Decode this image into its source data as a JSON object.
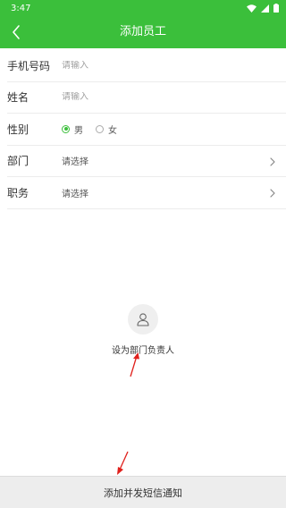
{
  "status_bar": {
    "time": "3:47"
  },
  "app_bar": {
    "title": "添加员工",
    "back_icon": "chevron-left-icon"
  },
  "form": {
    "phone": {
      "label": "手机号码",
      "placeholder": "请输入",
      "value": ""
    },
    "name": {
      "label": "姓名",
      "placeholder": "请输入",
      "value": ""
    },
    "gender": {
      "label": "性别",
      "options": [
        {
          "label": "男",
          "checked": true
        },
        {
          "label": "女",
          "checked": false
        }
      ]
    },
    "department": {
      "label": "部门",
      "value": "请选择"
    },
    "position": {
      "label": "职务",
      "value": "请选择"
    }
  },
  "dept_head": {
    "label": "设为部门负责人",
    "icon": "person-icon"
  },
  "bottom": {
    "submit_label": "添加并发短信通知"
  },
  "colors": {
    "accent": "#3bbf3b",
    "annotation": "#e0201c",
    "bottom_bar": "#ededed"
  }
}
